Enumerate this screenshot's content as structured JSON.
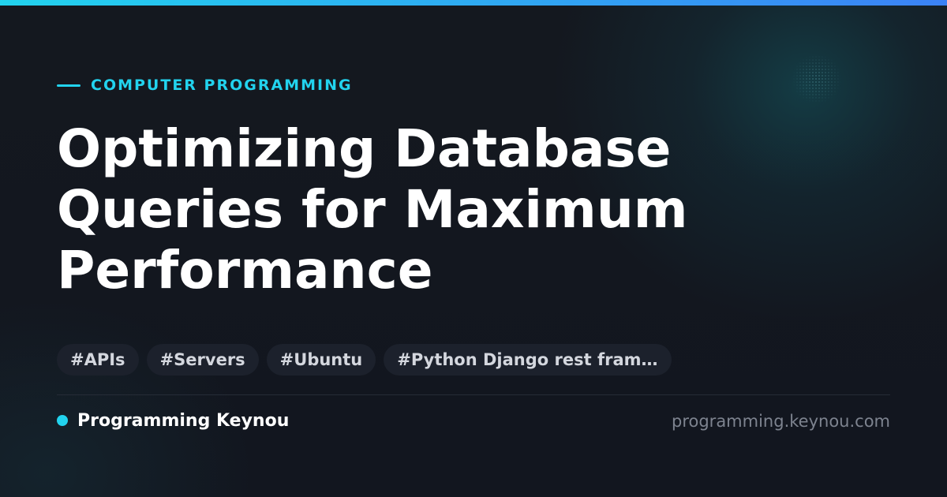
{
  "category": "COMPUTER PROGRAMMING",
  "title": "Optimizing Database Queries for Maximum Performance",
  "tags": [
    "#APIs",
    "#Servers",
    "#Ubuntu",
    "#Python Django rest fram…"
  ],
  "brand": {
    "name": "Programming Keynou",
    "url": "programming.keynou.com"
  },
  "colors": {
    "accent": "#22d3ee",
    "accent_gradient_end": "#3b82f6",
    "background": "#12161f"
  }
}
